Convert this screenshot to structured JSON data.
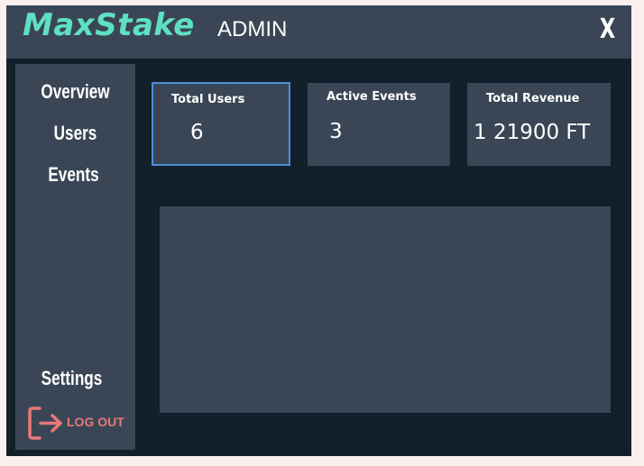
{
  "header": {
    "brand": "MaxStake",
    "section": "ADMIN",
    "close_label": "X"
  },
  "sidebar": {
    "items": [
      {
        "label": "Overview"
      },
      {
        "label": "Users"
      },
      {
        "label": "Events"
      }
    ],
    "settings_label": "Settings",
    "logout_label": "LOG OUT",
    "logout_icon": "logout-icon"
  },
  "stats": [
    {
      "title": "Total Users",
      "value": "6",
      "selected": true
    },
    {
      "title": "Active Events",
      "value": "3",
      "selected": false
    },
    {
      "title": "Total Revenue",
      "value": "1 21900 FT",
      "selected": false
    }
  ],
  "colors": {
    "brand": "#5fe0c4",
    "background": "#131f2b",
    "panel": "#3a4655",
    "accent": "#4a8fd8",
    "logout": "#e8787a"
  }
}
